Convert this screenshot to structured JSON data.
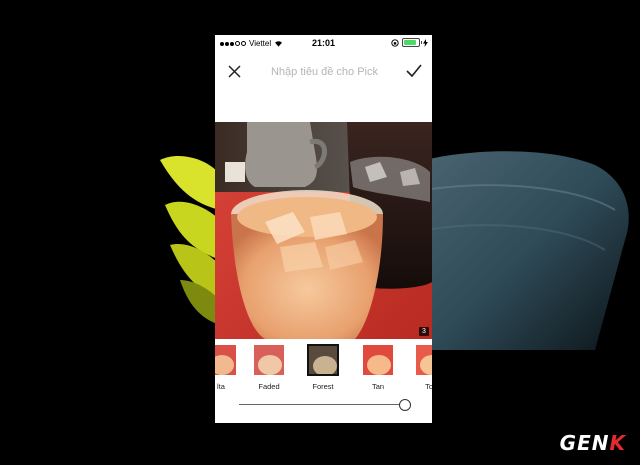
{
  "status_bar": {
    "carrier": "Viettel",
    "time": "21:01",
    "battery_level": 0.85
  },
  "header": {
    "title_placeholder": "Nhập tiêu đề cho Pick",
    "close_icon": "close-icon",
    "confirm_icon": "checkmark-icon"
  },
  "photo": {
    "badge": "3"
  },
  "filters": [
    {
      "label": "lta",
      "selected": false
    },
    {
      "label": "Faded",
      "selected": false
    },
    {
      "label": "Forest",
      "selected": true
    },
    {
      "label": "Tan",
      "selected": false
    },
    {
      "label": "Tok",
      "selected": false
    }
  ],
  "filter_strength": 1.0,
  "watermark": {
    "text_prefix": "GEN",
    "text_suffix": "K"
  },
  "colors": {
    "accent_knob_border": "#333333",
    "battery": "#4cd964",
    "watermark_red": "#e32b2b"
  }
}
